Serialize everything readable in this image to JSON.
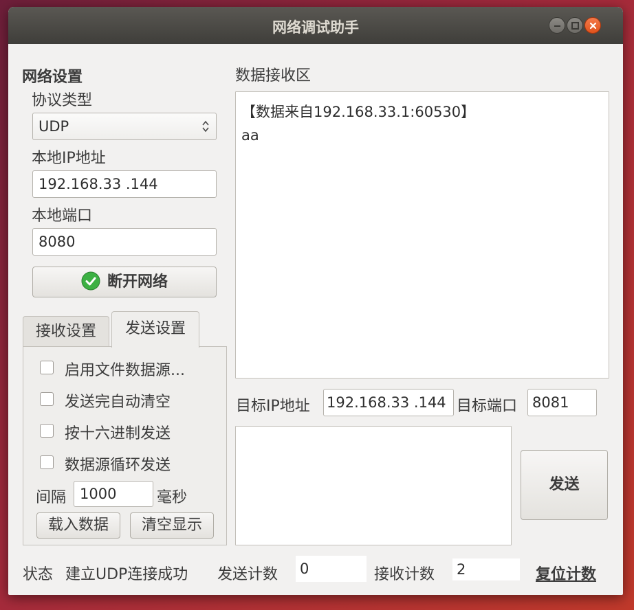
{
  "window": {
    "title": "网络调试助手"
  },
  "network": {
    "section_title": "网络设置",
    "protocol_label": "协议类型",
    "protocol_value": "UDP",
    "local_ip_label": "本地IP地址",
    "local_ip_value": "192.168.33 .144",
    "local_port_label": "本地端口",
    "local_port_value": "8080",
    "connect_button": "断开网络"
  },
  "tabs": [
    {
      "label": "接收设置"
    },
    {
      "label": "发送设置"
    }
  ],
  "send_settings": {
    "options": [
      {
        "label": "启用文件数据源...",
        "checked": false
      },
      {
        "label": "发送完自动清空",
        "checked": false
      },
      {
        "label": "按十六进制发送",
        "checked": false
      },
      {
        "label": "数据源循环发送",
        "checked": false
      }
    ],
    "interval_label": "间隔",
    "interval_value": "1000",
    "interval_unit": "毫秒",
    "load_button": "载入数据",
    "clear_button": "清空显示"
  },
  "receive": {
    "title": "数据接收区",
    "lines": [
      "【数据来自192.168.33.1:60530】",
      "aa"
    ]
  },
  "target": {
    "ip_label": "目标IP地址",
    "ip_value": "192.168.33 .144",
    "port_label": "目标端口",
    "port_value": "8081"
  },
  "send": {
    "input_value": "",
    "button": "发送"
  },
  "status": {
    "label": "状态",
    "message": "建立UDP连接成功",
    "send_count_label": "发送计数",
    "send_count": "0",
    "recv_count_label": "接收计数",
    "recv_count": "2",
    "reset_link": "复位计数"
  },
  "colors": {
    "accent_green": "#3cb043",
    "close_orange": "#e95420"
  }
}
